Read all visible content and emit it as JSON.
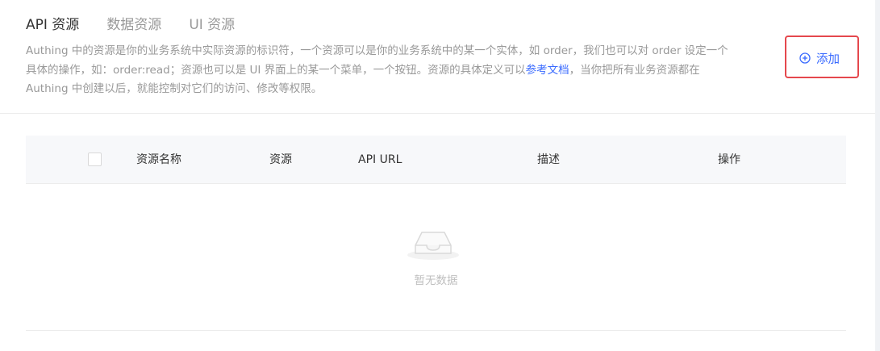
{
  "tabs": [
    {
      "label": "API 资源",
      "active": true
    },
    {
      "label": "数据资源",
      "active": false
    },
    {
      "label": "UI 资源",
      "active": false
    }
  ],
  "description": {
    "text": "Authing 中的资源是你的业务系统中实际资源的标识符，一个资源可以是你的业务系统中的某一个实体，如 order，我们也可以对 order 设定一个具体的操作，如：order:read；资源也可以是 UI 界面上的某一个菜单，一个按钮。资源的具体定义可以",
    "link": "参考文档",
    "after": "，当你把所有业务资源都在 Authing 中创建以后，就能控制对它们的访问、修改等权限。"
  },
  "add_button": {
    "label": "添加",
    "icon": "plus-circle-icon"
  },
  "table": {
    "columns": [
      "资源名称",
      "资源",
      "API URL",
      "描述",
      "操作"
    ],
    "rows": [],
    "empty_text": "暂无数据"
  },
  "colors": {
    "accent": "#396aff",
    "highlight": "#e5484d",
    "header_bg": "#f7f8fa"
  }
}
